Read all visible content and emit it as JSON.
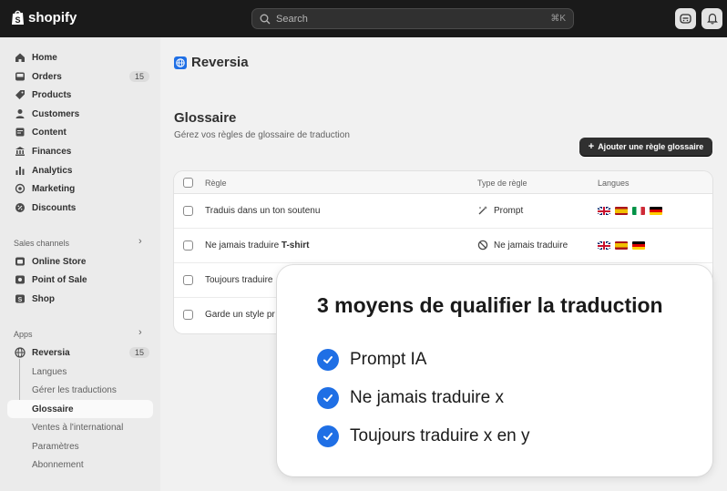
{
  "topbar": {
    "logo": "shopify",
    "search_placeholder": "Search",
    "search_shortcut": "⌘K"
  },
  "sidebar": {
    "items": [
      {
        "label": "Home",
        "icon": "home-icon"
      },
      {
        "label": "Orders",
        "icon": "inbox-icon",
        "badge": "15"
      },
      {
        "label": "Products",
        "icon": "tag-icon"
      },
      {
        "label": "Customers",
        "icon": "person-icon"
      },
      {
        "label": "Content",
        "icon": "document-icon"
      },
      {
        "label": "Finances",
        "icon": "bank-icon"
      },
      {
        "label": "Analytics",
        "icon": "bar-chart-icon"
      },
      {
        "label": "Marketing",
        "icon": "target-icon"
      },
      {
        "label": "Discounts",
        "icon": "discount-icon"
      }
    ],
    "sales_channels_label": "Sales channels",
    "channels": [
      {
        "label": "Online Store",
        "icon": "store-icon"
      },
      {
        "label": "Point of Sale",
        "icon": "pos-icon"
      },
      {
        "label": "Shop",
        "icon": "shop-icon"
      }
    ],
    "apps_label": "Apps",
    "app": {
      "label": "Reversia",
      "badge": "15"
    },
    "app_sub": [
      {
        "label": "Langues"
      },
      {
        "label": "Gérer les traductions"
      },
      {
        "label": "Glossaire",
        "active": true
      },
      {
        "label": "Ventes à l'international"
      },
      {
        "label": "Paramètres"
      },
      {
        "label": "Abonnement"
      }
    ]
  },
  "main": {
    "app_name": "Reversia",
    "title": "Glossaire",
    "subtitle": "Gérez vos règles de glossaire de traduction",
    "add_button": "Ajouter une règle glossaire",
    "table": {
      "headers": [
        "Règle",
        "Type de règle",
        "Langues"
      ],
      "rows": [
        {
          "rule": "Traduis dans un ton soutenu",
          "rule_bold": "",
          "type": "Prompt",
          "type_icon": "wand-icon",
          "flags": [
            "uk",
            "es",
            "it",
            "de"
          ]
        },
        {
          "rule": "Ne jamais traduire ",
          "rule_bold": "T-shirt",
          "type": "Ne jamais traduire",
          "type_icon": "prohibited-icon",
          "flags": [
            "uk",
            "es",
            "de"
          ]
        },
        {
          "rule": "Toujours traduire",
          "rule_bold": "",
          "type": "",
          "type_icon": "",
          "flags": []
        },
        {
          "rule": "Garde un style pr",
          "rule_bold": "",
          "type": "",
          "type_icon": "",
          "flags": []
        }
      ]
    }
  },
  "overlay": {
    "title": "3 moyens de qualifier la traduction",
    "items": [
      "Prompt IA",
      "Ne jamais traduire x",
      "Toujours traduire x en y"
    ],
    "check_color": "#1f6fe5"
  }
}
